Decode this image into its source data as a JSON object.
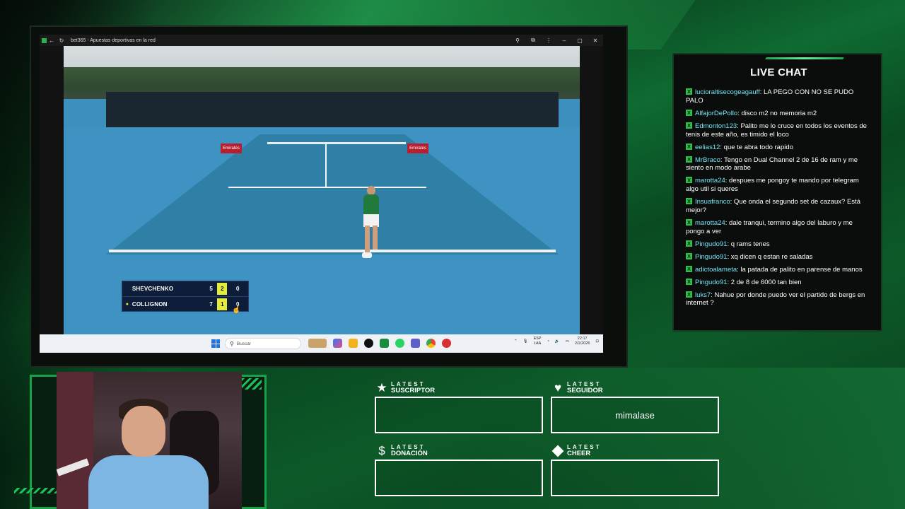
{
  "browser": {
    "tab_title": "bet365 - Apuestas deportivas en la red"
  },
  "scoreboard": {
    "players": [
      {
        "name": "SHEVCHENKO",
        "set": "5",
        "game": "2",
        "point": "0",
        "serving": false
      },
      {
        "name": "COLLIGNON",
        "set": "7",
        "game": "1",
        "point": "0",
        "serving": true
      }
    ],
    "serve_marker": "●"
  },
  "video": {
    "banners": [
      "Emirates",
      "Emirates"
    ]
  },
  "taskbar": {
    "search_placeholder": "Buscar",
    "lang_top": "ESP",
    "lang_bottom": "LAA",
    "time": "22:17",
    "date": "2/1/2026"
  },
  "chat": {
    "title": "LIVE CHAT",
    "messages": [
      {
        "user": "lucioraltisecogeagauff",
        "text": ": LA PEGO CON NO SE PUDO PALO"
      },
      {
        "user": "AlfajorDePollo",
        "text": ": disco m2 no memoria m2"
      },
      {
        "user": "Edmonton123",
        "text": ": Palito me lo cruce en todos los eventos de tenis de este año, es timido el loco"
      },
      {
        "user": "eelias12",
        "text": ": que te abra todo rapido"
      },
      {
        "user": "MrBraco",
        "text": ": Tengo en Dual Channel 2 de 16 de ram y me siento en modo arabe"
      },
      {
        "user": "marotta24",
        "text": ": despues me pongoy te mando por telegram algo util si queres"
      },
      {
        "user": "Insuafranco",
        "text": ": Que onda el segundo set de cazaux? Está mejor?"
      },
      {
        "user": "marotta24",
        "text": ": dale tranqui, termino algo del laburo y me pongo a ver"
      },
      {
        "user": "Pingudo91",
        "text": ": q rams tenes"
      },
      {
        "user": "Pingudo91",
        "text": ": xq dicen q estan re saladas"
      },
      {
        "user": "adictoalameta",
        "text": ": la patada de palito en parense de manos"
      },
      {
        "user": "Pingudo91",
        "text": ": 2 de 8 de 6000 tan bien"
      },
      {
        "user": "luks7",
        "text": ": Nahue por donde puedo ver el partido de bergs en internet ?"
      }
    ]
  },
  "widgets": {
    "suscriptor": {
      "small": "LATEST",
      "big": "SUSCRIPTOR",
      "icon": "★",
      "value": ""
    },
    "seguidor": {
      "small": "LATEST",
      "big": "SEGUIDOR",
      "icon": "♥",
      "value": "mimalase"
    },
    "donacion": {
      "small": "LATEST",
      "big": "DONACIÓN",
      "icon": "$",
      "value": ""
    },
    "cheer": {
      "small": "LATEST",
      "big": "CHEER",
      "value": ""
    }
  },
  "colors": {
    "accent_green": "#1fc15a",
    "chat_user": "#74e3f3",
    "score_highlight": "#e4ec3a"
  }
}
